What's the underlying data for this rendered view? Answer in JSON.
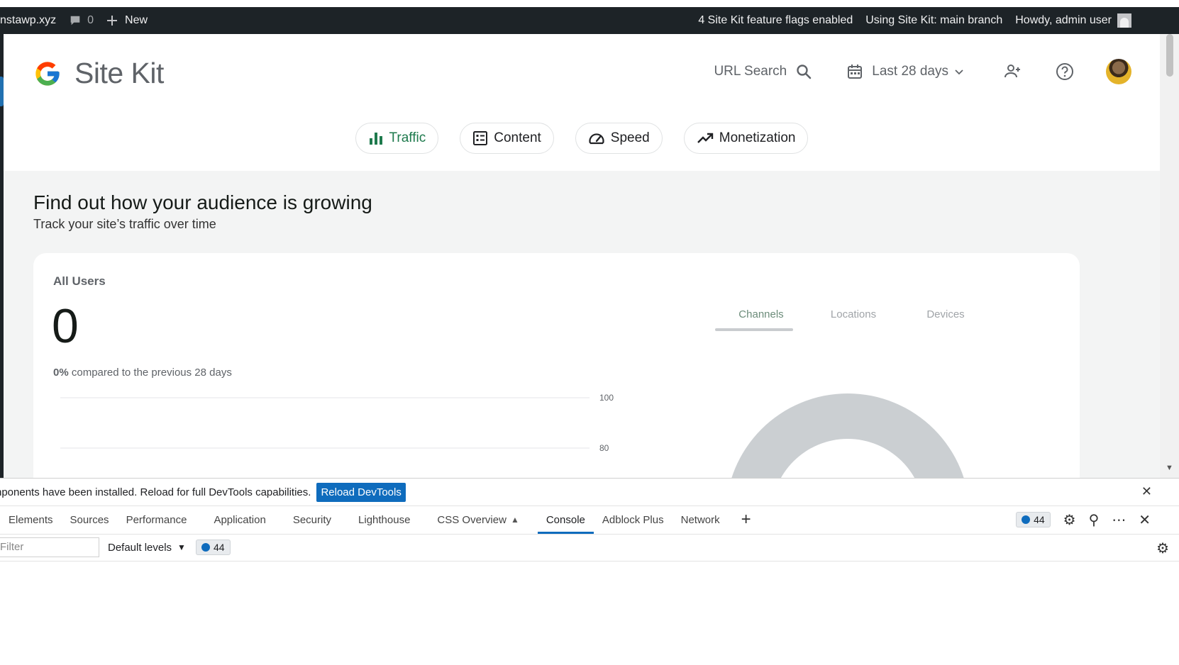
{
  "adminbar": {
    "site": "nstawp.xyz",
    "comments_count": "0",
    "new_label": "New",
    "feature_flags": "4 Site Kit feature flags enabled",
    "branch": "Using Site Kit: main branch",
    "howdy": "Howdy, admin user"
  },
  "header": {
    "title": "Site Kit",
    "url_search": "URL Search",
    "date_range": "Last 28 days"
  },
  "chips": [
    {
      "label": "Traffic",
      "icon": "bar-chart-icon"
    },
    {
      "label": "Content",
      "icon": "content-icon"
    },
    {
      "label": "Speed",
      "icon": "speedometer-icon"
    },
    {
      "label": "Monetization",
      "icon": "trending-up-icon"
    }
  ],
  "section": {
    "title": "Find out how your audience is growing",
    "subtitle": "Track your site’s traffic over time"
  },
  "card": {
    "metric_label": "All Users",
    "metric_value": "0",
    "change": "0%",
    "compare_text": "compared to the previous 28 days",
    "tabs": [
      "Channels",
      "Locations",
      "Devices"
    ]
  },
  "chart_data": {
    "type": "line",
    "y_ticks": [
      "100",
      "80"
    ],
    "series": []
  },
  "devtools": {
    "info_message": "nponents have been installed. Reload for full DevTools capabilities.",
    "reload_button": "Reload DevTools",
    "tabs": [
      "Elements",
      "Sources",
      "Performance",
      "Application",
      "Security",
      "Lighthouse",
      "CSS Overview",
      "Console",
      "Adblock Plus",
      "Network"
    ],
    "active_tab": "Console",
    "message_count": "44",
    "filter_placeholder": "Filter",
    "levels": "Default levels"
  },
  "colors": {
    "adminbar_bg": "#1d2327",
    "active_chip": "#1e7a4d",
    "devtools_accent": "#0f6cbd"
  }
}
